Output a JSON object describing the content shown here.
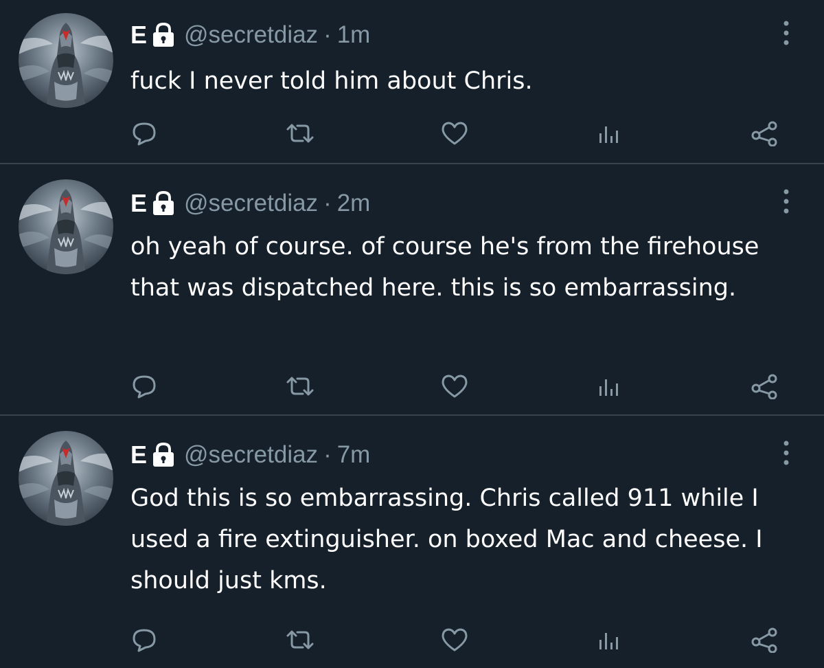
{
  "tweets": [
    {
      "name": "E",
      "handle": "@secretdiaz",
      "separator": "·",
      "time": "1m",
      "text": "fuck I never told him about Chris."
    },
    {
      "name": "E",
      "handle": "@secretdiaz",
      "separator": "·",
      "time": "2m",
      "text": "oh yeah of course. of course he's from the firehouse that was dispatched here. this is so embarrassing."
    },
    {
      "name": "E",
      "handle": "@secretdiaz",
      "separator": "·",
      "time": "7m",
      "text": "God this is so embarrassing. Chris called 911 while I used a fire extinguisher. on boxed Mac and cheese. I should just kms."
    }
  ],
  "icons": {
    "avatar": "howling-wolf-avatar",
    "lock": "lock-icon",
    "more": "more-vertical-icon",
    "reply": "reply-icon",
    "retweet": "retweet-icon",
    "like": "heart-icon",
    "analytics": "analytics-icon",
    "share": "share-icon"
  },
  "colors": {
    "background": "#15202b",
    "secondary_text": "#8899a6",
    "divider": "#38444d"
  }
}
